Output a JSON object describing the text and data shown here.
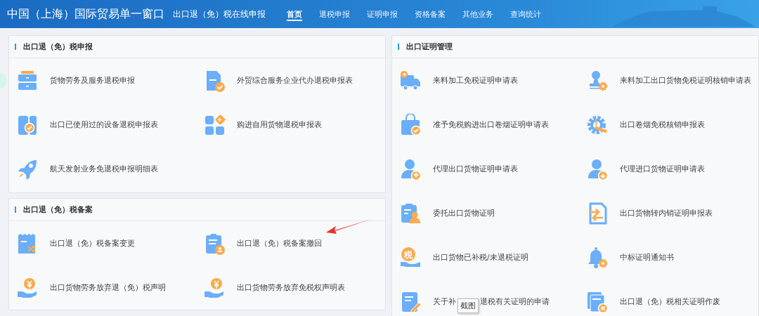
{
  "header": {
    "title": "中国（上海）国际贸易单一窗口",
    "subtitle": "出口退（免）税在线申报"
  },
  "nav": [
    {
      "label": "首页",
      "selected": true
    },
    {
      "label": "退税申报",
      "selected": false
    },
    {
      "label": "证明申报",
      "selected": false
    },
    {
      "label": "资格备案",
      "selected": false
    },
    {
      "label": "其他业务",
      "selected": false
    },
    {
      "label": "查询统计",
      "selected": false
    }
  ],
  "sections": [
    {
      "title": "出口退（免）税申报",
      "items": [
        {
          "label": "货物劳务及服务退税申报"
        },
        {
          "label": "外贸综合服务企业代办退税申报表"
        },
        {
          "label": "出口已使用过的设备退税申报表"
        },
        {
          "label": "购进自用货物退税申报表"
        },
        {
          "label": "航天发射业务免退税申报明细表"
        }
      ]
    },
    {
      "title": "出口退（免）税备案",
      "items": [
        {
          "label": "出口退（免）税备案变更"
        },
        {
          "label": "出口退（免）税备案撤回"
        },
        {
          "label": "出口货物劳务放弃退（免）税声明"
        },
        {
          "label": "出口货物劳务放弃免税权声明表"
        }
      ]
    },
    {
      "title": "出口证明管理",
      "items": [
        {
          "label": "来料加工免税证明申请表"
        },
        {
          "label": "来料加工出口货物免税证明核销申请表"
        },
        {
          "label": "准予免税购进出口卷烟证明申请表"
        },
        {
          "label": "出口卷烟免税核销申报表"
        },
        {
          "label": "代理出口货物证明申请表"
        },
        {
          "label": "代理进口货物证明申请表"
        },
        {
          "label": "委托出口货物证明"
        },
        {
          "label": "出口货物转内销证明申报表"
        },
        {
          "label": "出口货物已补税/未退税证明",
          "icon_text": "税"
        },
        {
          "label": "中标证明通知书"
        },
        {
          "label": "关于补",
          "tooltip": "截图",
          "label_end": "退税有关证明的申请"
        },
        {
          "label": "出口退（免）税相关证明作废"
        }
      ]
    }
  ]
}
